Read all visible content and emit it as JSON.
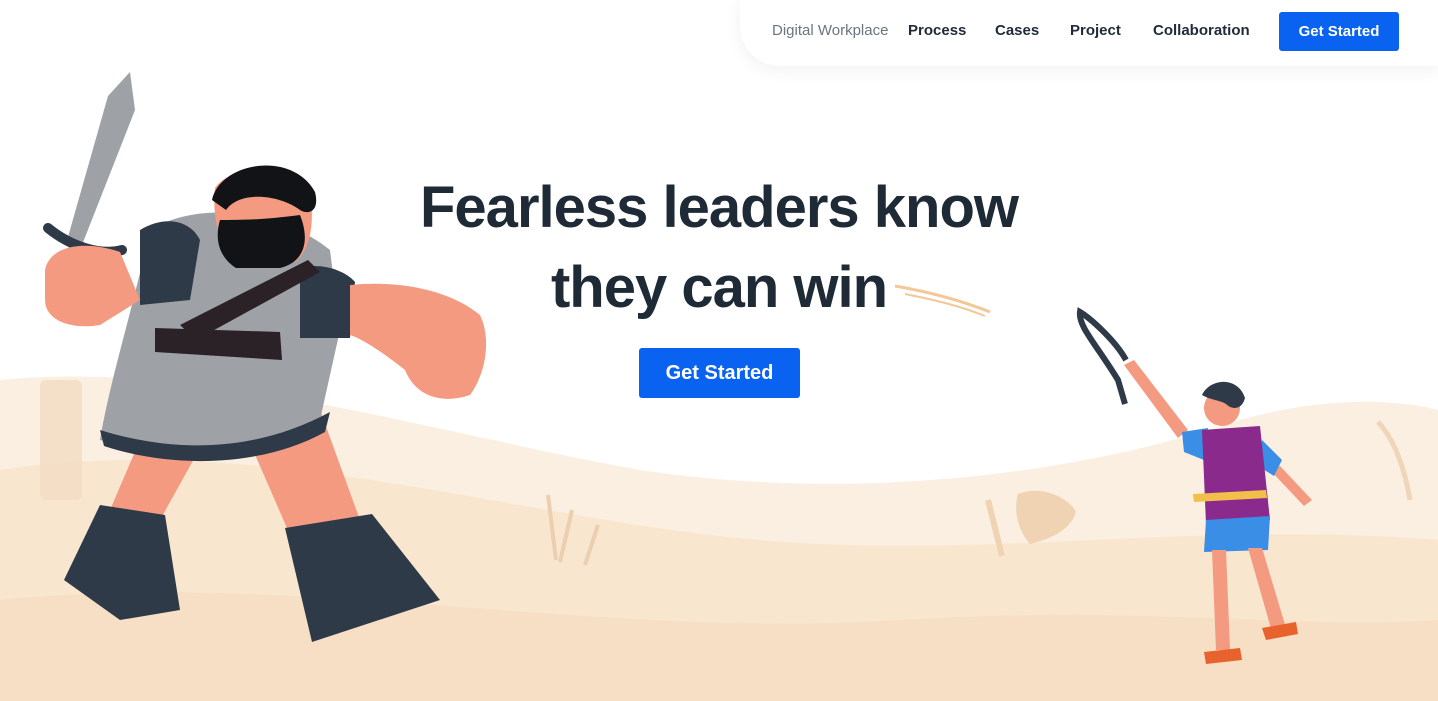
{
  "nav": {
    "items": [
      {
        "label": "Digital Workplace"
      },
      {
        "label": "Process"
      },
      {
        "label": "Cases"
      },
      {
        "label": "Project"
      },
      {
        "label": "Collaboration"
      }
    ],
    "cta_label": "Get Started"
  },
  "hero": {
    "headline_line1": "Fearless leaders know",
    "headline_line2": "they can win",
    "cta_label": "Get Started"
  },
  "colors": {
    "accent": "#0a63f0",
    "headline": "#1e2a36",
    "sand": "#f9e8d3",
    "goliath_armor": "#2e3a47",
    "david_tunic": "#8a2a8c"
  },
  "illustration": {
    "characters": [
      "goliath-giant-illustration",
      "david-slingshot-illustration"
    ]
  }
}
